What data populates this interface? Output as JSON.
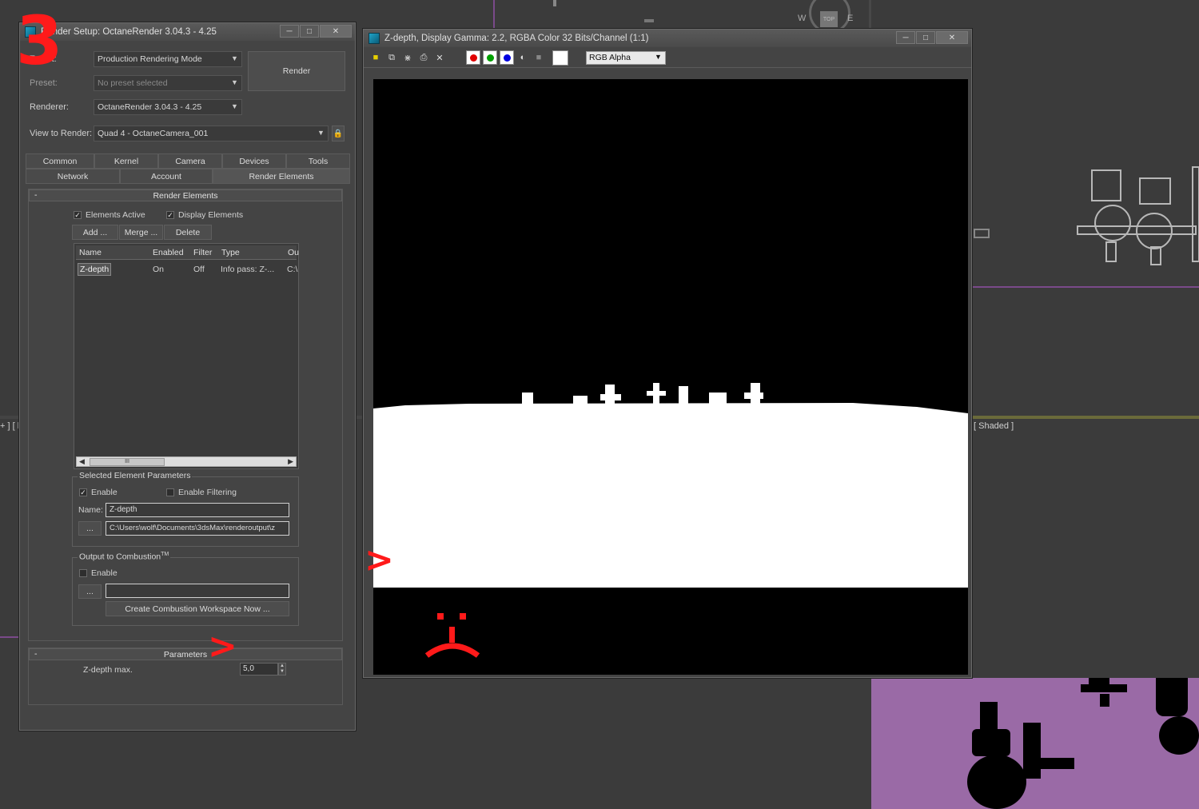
{
  "viewport": {
    "bracket_left": "+ ] [ l",
    "shaded_label": "[ Shaded ]",
    "compass": {
      "w": "W",
      "e": "E",
      "top": "TOP"
    }
  },
  "annotations": {
    "step_number": "3",
    "arrow": ">",
    "sad_face": ":("
  },
  "render_setup": {
    "title": "Render Setup: OctaneRender 3.04.3 - 4.25",
    "target_label": "Target:",
    "target_value": "Production Rendering Mode",
    "preset_label": "Preset:",
    "preset_value": "No preset selected",
    "renderer_label": "Renderer:",
    "renderer_value": "OctaneRender 3.04.3 - 4.25",
    "view_label": "View to Render:",
    "view_value": "Quad 4 - OctaneCamera_001",
    "render_button": "Render",
    "tabs_row1": [
      "Common",
      "Kernel",
      "Camera",
      "Devices",
      "Tools"
    ],
    "tabs_row2": [
      "Network",
      "Account",
      "Render Elements"
    ],
    "render_elements": {
      "heading": "Render Elements",
      "elements_active": "Elements Active",
      "display_elements": "Display Elements",
      "add": "Add ...",
      "merge": "Merge ...",
      "delete": "Delete",
      "columns": [
        "Name",
        "Enabled",
        "Filter",
        "Type",
        "Ou"
      ],
      "row": {
        "name": "Z-depth",
        "enabled": "On",
        "filter": "Off",
        "type": "Info pass: Z-...",
        "out": "C:\\"
      },
      "scroll_thumb": "III"
    },
    "selected_params": {
      "title": "Selected Element Parameters",
      "enable": "Enable",
      "enable_filtering": "Enable Filtering",
      "name_label": "Name:",
      "name_value": "Z-depth",
      "path_button": "...",
      "path_value": "C:\\Users\\wolf\\Documents\\3dsMax\\renderoutput\\z"
    },
    "combustion": {
      "title": "Output to Combustion",
      "tm": "TM",
      "enable": "Enable",
      "path_button": "...",
      "path_value": "",
      "create_button": "Create Combustion Workspace Now ..."
    },
    "parameters": {
      "heading": "Parameters",
      "zdepth_label": "Z-depth max.",
      "zdepth_value": "5,0"
    },
    "minus": "-"
  },
  "frame_buffer": {
    "title": "Z-depth, Display Gamma: 2.2, RGBA Color 32 Bits/Channel (1:1)",
    "channel_select": "RGB Alpha",
    "colors": {
      "red": "#e00000",
      "green": "#00a000",
      "blue": "#0000e0"
    }
  }
}
